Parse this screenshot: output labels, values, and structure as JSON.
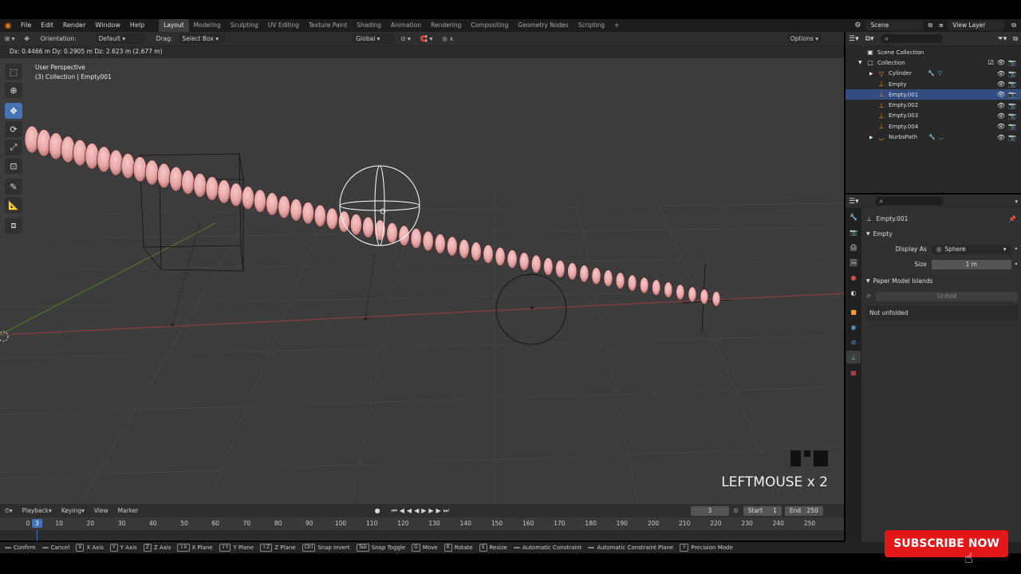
{
  "menu": [
    "File",
    "Edit",
    "Render",
    "Window",
    "Help"
  ],
  "workspaces": [
    "Layout",
    "Modeling",
    "Sculpting",
    "UV Editing",
    "Texture Paint",
    "Shading",
    "Animation",
    "Rendering",
    "Compositing",
    "Geometry Nodes",
    "Scripting",
    "+"
  ],
  "active_workspace": "Layout",
  "scene_name": "Scene",
  "view_layer": "View Layer",
  "viewport": {
    "orientation_label": "Orientation:",
    "orientation_value": "Default",
    "drag_label": "Drag:",
    "drag_value": "Select Box",
    "transform_space": "Global",
    "options": "Options",
    "status_text": "Dx: 0.4466 m   Dy: 0.2905 m   Dz: 2.623 m (2.677 m)",
    "perspective": "User Perspective",
    "collection_info": "(3) Collection | Empty001",
    "overlay_text": "LEFTMOUSE x 2"
  },
  "outliner": {
    "root": "Scene Collection",
    "collection": "Collection",
    "items": [
      {
        "name": "Cylinder",
        "selected": false
      },
      {
        "name": "Empty",
        "selected": false
      },
      {
        "name": "Empty.001",
        "selected": true
      },
      {
        "name": "Empty.002",
        "selected": false
      },
      {
        "name": "Empty.003",
        "selected": false
      },
      {
        "name": "Empty.004",
        "selected": false
      },
      {
        "name": "NurbsPath",
        "selected": false
      }
    ]
  },
  "properties": {
    "object_name": "Empty.001",
    "section_empty": "Empty",
    "display_as_label": "Display As",
    "display_as_value": "Sphere",
    "size_label": "Size",
    "size_value": "1 m",
    "section_paper": "Paper Model Islands",
    "unfold_button": "Unfold",
    "unfold_status": "Not unfolded"
  },
  "timeline": {
    "menus": [
      "Playback",
      "Keying",
      "View",
      "Marker"
    ],
    "current_frame": "3",
    "start_label": "Start",
    "start_value": "1",
    "end_label": "End",
    "end_value": "250",
    "ruler": [
      "0",
      "10",
      "20",
      "30",
      "40",
      "50",
      "60",
      "70",
      "80",
      "90",
      "100",
      "110",
      "120",
      "130",
      "140",
      "150",
      "160",
      "170",
      "180",
      "190",
      "200",
      "210",
      "220",
      "230",
      "240",
      "250"
    ]
  },
  "statusbar": [
    {
      "key": "",
      "label": "Confirm"
    },
    {
      "key": "",
      "label": "Cancel"
    },
    {
      "key": "X",
      "label": "X Axis"
    },
    {
      "key": "Y",
      "label": "Y Axis"
    },
    {
      "key": "Z",
      "label": "Z Axis"
    },
    {
      "key": "⇧X",
      "label": "X Plane"
    },
    {
      "key": "⇧Y",
      "label": "Y Plane"
    },
    {
      "key": "⇧Z",
      "label": "Z Plane"
    },
    {
      "key": "Ctrl",
      "label": "Snap Invert"
    },
    {
      "key": "Tab",
      "label": "Snap Toggle"
    },
    {
      "key": "G",
      "label": "Move"
    },
    {
      "key": "R",
      "label": "Rotate"
    },
    {
      "key": "S",
      "label": "Resize"
    },
    {
      "key": "",
      "label": "Automatic Constraint"
    },
    {
      "key": "",
      "label": "Automatic Constraint Plane"
    },
    {
      "key": "⇧",
      "label": "Precision Mode"
    }
  ],
  "subscribe_label": "SUBSCRIBE NOW",
  "colors": {
    "bead": "#e8a5a5",
    "selected_row": "#334d80",
    "active_tool": "#4772b3",
    "subscribe_bg": "#e31717",
    "axis_x": "#9a3c3c",
    "axis_y": "#5a7a2a"
  }
}
